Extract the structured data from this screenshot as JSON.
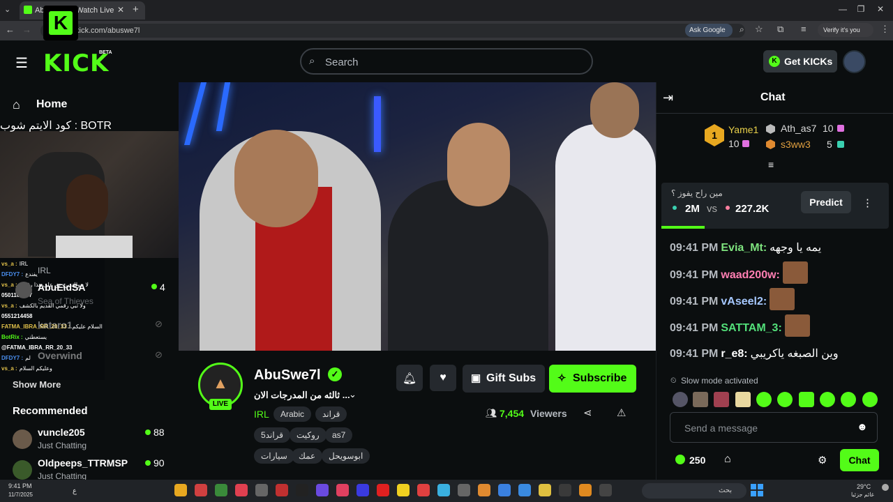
{
  "browser": {
    "tab_title": "AbuSwe7l - Watch Live",
    "url": "kick.com/abuswe7l",
    "ask_google": "Ask Google",
    "verify": "Verify it's you"
  },
  "header": {
    "logo": "KICK",
    "beta": "BETA",
    "search_placeholder": "Search",
    "get_kicks": "Get KICKs"
  },
  "sidebar": {
    "home": "Home",
    "overlay_botr": "كود الايتم شوب : BOTR",
    "items": [
      {
        "name": "AbuEidSA",
        "sub": "IRL",
        "count": "4"
      },
      {
        "name": "Sea of Thieves",
        "sub": "",
        "count": ""
      },
      {
        "name": "kataro1",
        "sub": "",
        "count": ""
      },
      {
        "name": "Overwind",
        "sub": "",
        "count": ""
      }
    ],
    "show_more": "Show More",
    "recommended_label": "Recommended",
    "recommended": [
      {
        "name": "vuncle205",
        "sub": "Just Chatting",
        "count": "88"
      },
      {
        "name": "Oldpeeps_TTRMSP",
        "sub": "Just Chatting",
        "count": "90"
      }
    ],
    "overlay_chat": [
      {
        "user": "vs_a :",
        "text": "IRL",
        "color": "#e0c04a"
      },
      {
        "user": "DFDY7 :",
        "text": "يفندع",
        "color": "#4a8ff0"
      },
      {
        "user": "vs_a :",
        "text": "لا حولك يرو نق على هذا رقمي",
        "color": "#e0c04a"
      },
      {
        "user": "0501163477",
        "text": "",
        "color": "#ffffff"
      },
      {
        "user": "vs_a :",
        "text": "ولا تبي رقمي القديم بالكشف",
        "color": "#e0c04a"
      },
      {
        "user": "0551214458",
        "text": "",
        "color": "#ffffff"
      },
      {
        "user": "FATMA_IBRA_RR_20_33 :",
        "text": "السلام عليكم",
        "color": "#e0c04a"
      },
      {
        "user": "BotRix :",
        "text": "يستعطني",
        "color": "#53fc18"
      },
      {
        "user": "@FATMA_IBRA_RR_20_33",
        "text": "",
        "color": "#ffffff"
      },
      {
        "user": "DFDY7 :",
        "text": "لم",
        "color": "#4a8ff0"
      },
      {
        "user": "vs_a :",
        "text": "وعليكم السلام",
        "color": "#e0c04a"
      }
    ]
  },
  "channel": {
    "name": "AbuSwe7l",
    "live": "LIVE",
    "stream_title": "ثالثه من المدرجات الان ...",
    "category": "IRL",
    "tags": [
      "Arabic",
      "قراند",
      "قراند5",
      "روكيت",
      "as7",
      "سيارات",
      "عمك",
      "ابوسويحل"
    ],
    "gift_subs": "Gift Subs",
    "subscribe": "Subscribe",
    "viewers": "7,454",
    "viewers_label": "Viewers"
  },
  "chat": {
    "title": "Chat",
    "leaderboard": [
      {
        "rank": "1",
        "name": "Yame1",
        "count": "10"
      },
      {
        "rank": "",
        "name": "Ath_as7",
        "count": "10"
      },
      {
        "rank": "",
        "name": "s3ww3",
        "count": "5"
      }
    ],
    "prediction": {
      "question": "مين راح يفوز ؟",
      "a": "2M",
      "vs": "vs",
      "b": "227.2K",
      "button": "Predict",
      "progress": 0.19
    },
    "messages": [
      {
        "time": "09:41 PM",
        "user": "Evia_Mt:",
        "text": "يمه يا وجهه",
        "color": "#7ee37e",
        "emote": false
      },
      {
        "time": "09:41 PM",
        "user": "waad200w:",
        "text": "",
        "color": "#ff7fb3",
        "emote": true
      },
      {
        "time": "09:41 PM",
        "user": "vAseel2:",
        "text": "",
        "color": "#a6c8ff",
        "emote": true
      },
      {
        "time": "09:41 PM",
        "user": "SATTAM_3:",
        "text": "",
        "color": "#53e07a",
        "emote": true
      },
      {
        "time": "09:41 PM",
        "user": "r_e8:",
        "text": "وين الصبغه ياكريبي",
        "color": "#ffffff",
        "emote": false
      }
    ],
    "slow_mode": "Slow mode activated",
    "input_placeholder": "Send a message",
    "points": "250",
    "send_button": "Chat"
  },
  "taskbar": {
    "time": "9:41 PM",
    "date": "11/7/2025",
    "lang": "ع",
    "search": "بحث",
    "weather_temp": "29°C",
    "weather_text": "غائم جزئيا"
  },
  "colors": {
    "accent": "#53fc18",
    "bg": "#0b0e0f",
    "surface": "#25292e"
  }
}
